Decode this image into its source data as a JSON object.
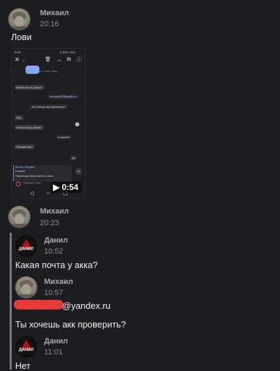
{
  "messages": [
    {
      "author": "Михаил",
      "time": "20:16",
      "text": "Лови"
    },
    {
      "author": "Михаил",
      "time": "20:23"
    }
  ],
  "video": {
    "duration": "0:54",
    "screen": {
      "status_time": "10:39",
      "status_right": "▯ 56:0 • 24 4",
      "top_counter": "1",
      "online_text": "в сети: 5 минут назад",
      "msgs": [
        {
          "side": "l",
          "text": "Какая почта у акка?"
        },
        {
          "side": "r",
          "text": "meshaa2007@yandex.ru"
        },
        {
          "side": "r",
          "text": "Ты хочешь акк проверить?"
        },
        {
          "side": "l",
          "text": "Нет"
        },
        {
          "side": "l",
          "text": "Хотел почту узнать"
        },
        {
          "side": "r",
          "text": "И зачем?"
        },
        {
          "side": "l",
          "text": "Личный акк?"
        },
        {
          "side": "r",
          "text": "Да"
        }
      ],
      "reply_name": "Михаил Абрамов",
      "reply_text": "И зачем?",
      "reply_body": "Племяннику брату жена его знать",
      "input_placeholder": "Отправьте ответ..."
    }
  },
  "quotes": [
    {
      "author": "Данил",
      "time": "10:52",
      "text": "Какая почта у акка?"
    },
    {
      "author": "Михаил",
      "time": "10:57",
      "text_suffix": "@yandex.ru",
      "text2": "Ты хочешь акк проверить?"
    },
    {
      "author": "Данил",
      "time": "11:01",
      "text": "Нет"
    }
  ],
  "clan_logo_text": "ДАНИЛ",
  "colors": {
    "background": "#1e1e22",
    "name": "#a8a8b0",
    "redaction": "#e53b3b"
  }
}
